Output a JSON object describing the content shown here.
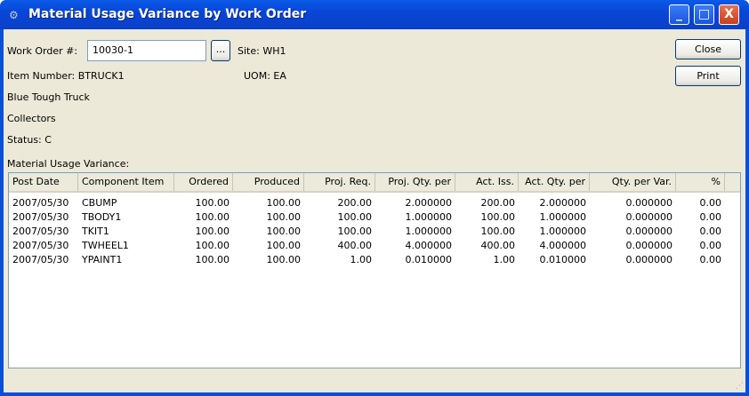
{
  "window": {
    "title": "Material Usage Variance by Work Order",
    "minimize": "_",
    "maximize": "□",
    "close": "X"
  },
  "form": {
    "work_order_label": "Work Order #:",
    "work_order_value": "10030-1",
    "lookup_label": "...",
    "site": "Site: WH1",
    "item_number": "Item Number: BTRUCK1",
    "uom": "UOM: EA",
    "description1": "Blue Tough Truck",
    "description2": "Collectors",
    "status": "Status: C",
    "section_label": "Material Usage Variance:"
  },
  "buttons": {
    "close": "Close",
    "print": "Print"
  },
  "table": {
    "columns": [
      "Post Date",
      "Component Item",
      "Ordered",
      "Produced",
      "Proj. Req.",
      "Proj. Qty. per",
      "Act. Iss.",
      "Act. Qty. per",
      "Qty. per Var.",
      "%"
    ],
    "rows": [
      [
        "2007/05/30",
        "CBUMP",
        "100.00",
        "100.00",
        "200.00",
        "2.000000",
        "200.00",
        "2.000000",
        "0.000000",
        "0.00"
      ],
      [
        "2007/05/30",
        "TBODY1",
        "100.00",
        "100.00",
        "100.00",
        "1.000000",
        "100.00",
        "1.000000",
        "0.000000",
        "0.00"
      ],
      [
        "2007/05/30",
        "TKIT1",
        "100.00",
        "100.00",
        "100.00",
        "1.000000",
        "100.00",
        "1.000000",
        "0.000000",
        "0.00"
      ],
      [
        "2007/05/30",
        "TWHEEL1",
        "100.00",
        "100.00",
        "400.00",
        "4.000000",
        "400.00",
        "4.000000",
        "0.000000",
        "0.00"
      ],
      [
        "2007/05/30",
        "YPAINT1",
        "100.00",
        "100.00",
        "1.00",
        "0.010000",
        "1.00",
        "0.010000",
        "0.000000",
        "0.00"
      ]
    ]
  }
}
